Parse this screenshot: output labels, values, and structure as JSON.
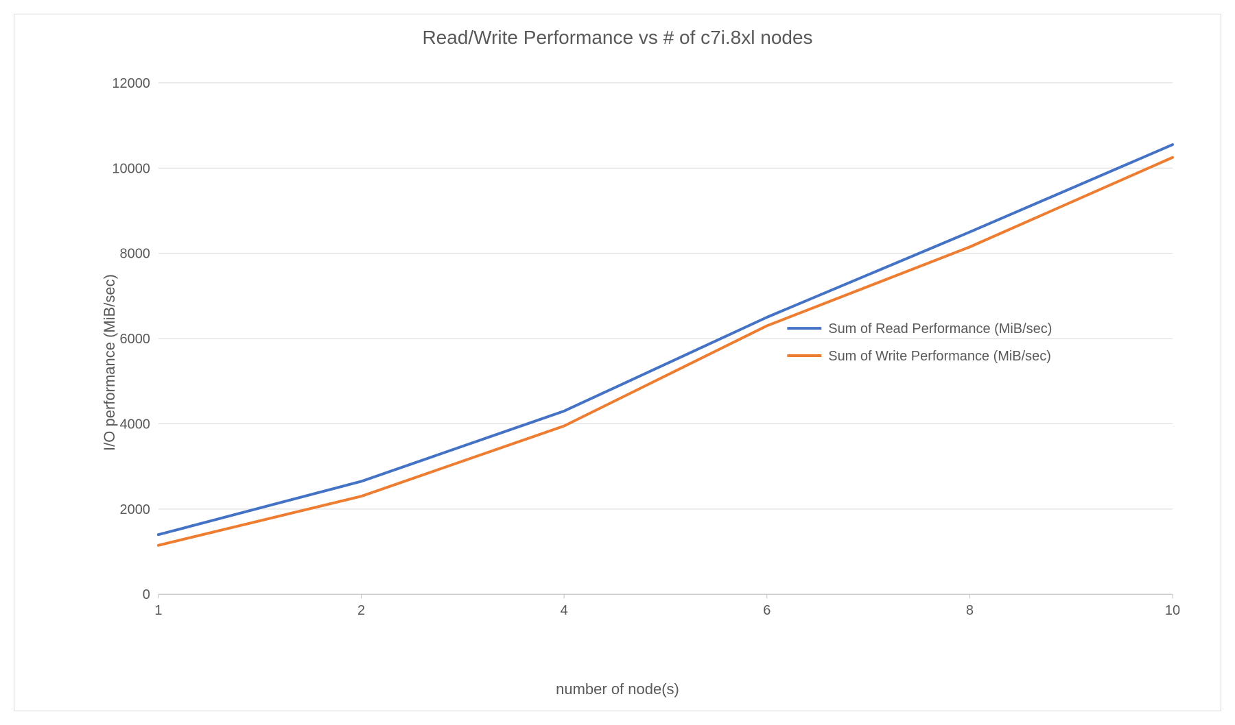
{
  "chart_data": {
    "type": "line",
    "title": "Read/Write Performance vs # of c7i.8xl nodes",
    "xlabel": "number of node(s)",
    "ylabel": "I/O performance (MiB/sec)",
    "categories": [
      "1",
      "2",
      "4",
      "6",
      "8",
      "10"
    ],
    "y_ticks": [
      0,
      2000,
      4000,
      6000,
      8000,
      10000,
      12000
    ],
    "ylim": [
      0,
      12000
    ],
    "series": [
      {
        "name": "Sum of Read Performance (MiB/sec)",
        "color": "#4472C4",
        "values": [
          1400,
          2650,
          4300,
          6500,
          8500,
          10550
        ]
      },
      {
        "name": "Sum of Write Performance (MiB/sec)",
        "color": "#ED7D31",
        "values": [
          1150,
          2300,
          3950,
          6300,
          8150,
          10250
        ]
      }
    ],
    "legend_position": "right"
  }
}
